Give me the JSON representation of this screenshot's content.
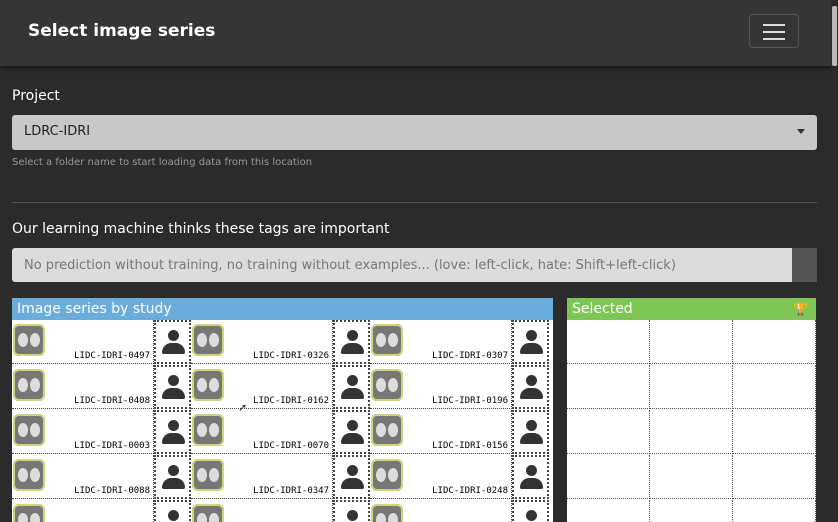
{
  "header": {
    "title": "Select image series"
  },
  "project": {
    "label": "Project",
    "selected": "LDRC-IDRI",
    "help": "Select a folder name to start loading data from this location"
  },
  "tags": {
    "label": "Our learning machine thinks these tags are important",
    "placeholder": "No prediction without training, no training without examples... (love: left-click, hate: Shift+left-click)"
  },
  "studies": {
    "title": "Image series by study",
    "rows": [
      [
        "LIDC-IDRI-0497",
        "LIDC-IDRI-0326",
        "LIDC-IDRI-0307"
      ],
      [
        "LIDC-IDRI-0408",
        "LIDC-IDRI-0162",
        "LIDC-IDRI-0196"
      ],
      [
        "LIDC-IDRI-0003",
        "LIDC-IDRI-0070",
        "LIDC-IDRI-0156"
      ],
      [
        "LIDC-IDRI-0088",
        "LIDC-IDRI-0347",
        "LIDC-IDRI-0248"
      ],
      [
        "",
        "",
        ""
      ]
    ]
  },
  "selected": {
    "title": "Selected",
    "icon": "trophy-icon"
  }
}
